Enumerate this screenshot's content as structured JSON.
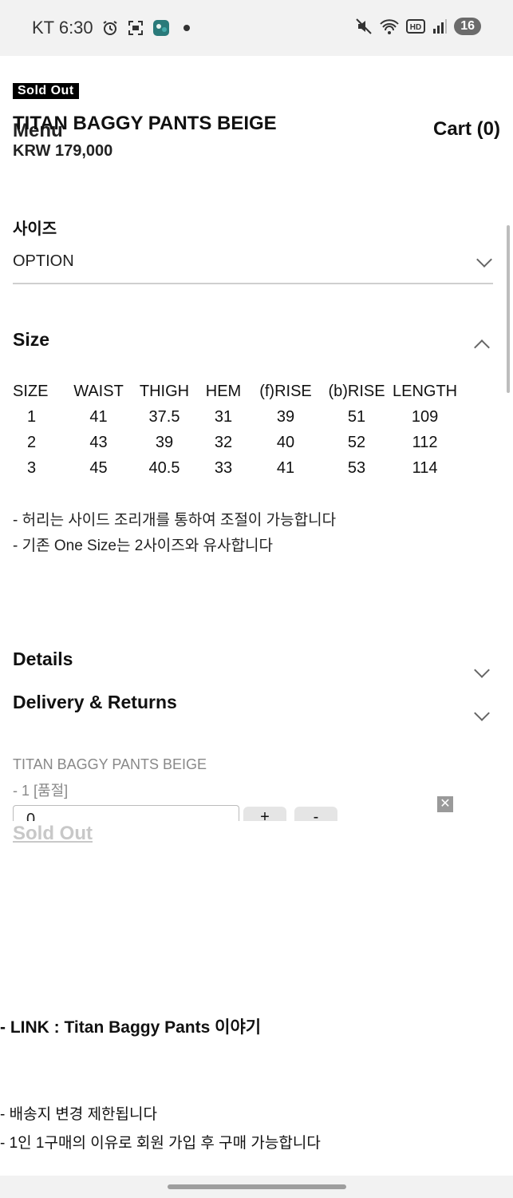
{
  "status_bar": {
    "carrier_time": "KT 6:30",
    "left_icons": [
      "alarm-icon",
      "screenshot-icon",
      "app-notification-icon",
      "dot-icon"
    ],
    "right_icons": [
      "mute-icon",
      "wifi-icon",
      "hd-icon",
      "signal-icon"
    ],
    "battery": "16"
  },
  "header": {
    "soldout_badge": "Sold Out",
    "menu": "Menu",
    "title": "TITAN BAGGY PANTS BEIGE",
    "cart": "Cart (0)",
    "price": "KRW 179,000"
  },
  "option": {
    "label": "사이즈",
    "value": "OPTION"
  },
  "size_section": {
    "heading": "Size",
    "columns": [
      "SIZE",
      "WAIST",
      "THIGH",
      "HEM",
      "(f)RISE",
      "(b)RISE",
      "LENGTH"
    ],
    "rows": [
      [
        "1",
        "41",
        "37.5",
        "31",
        "39",
        "51",
        "109"
      ],
      [
        "2",
        "43",
        "39",
        "32",
        "40",
        "52",
        "112"
      ],
      [
        "3",
        "45",
        "40.5",
        "33",
        "41",
        "53",
        "114"
      ]
    ],
    "notes": [
      "- 허리는 사이드 조리개를 통하여 조절이 가능합니다",
      "- 기존 One Size는 2사이즈와 유사합니다"
    ]
  },
  "accordions": {
    "details": "Details",
    "delivery": "Delivery & Returns"
  },
  "cart_item": {
    "name": "TITAN BAGGY PANTS BEIGE",
    "option": "- 1 [품절]",
    "quantity": "0",
    "plus": "+",
    "minus": "-",
    "close": "✕",
    "soldout": "Sold Out"
  },
  "description": {
    "link": "- LINK : Titan Baggy Pants 이야기",
    "lines": [
      "- 배송지 변경 제한됩니다",
      "- 1인 1구매의 이유로 회원 가입 후 구매 가능합니다"
    ]
  }
}
